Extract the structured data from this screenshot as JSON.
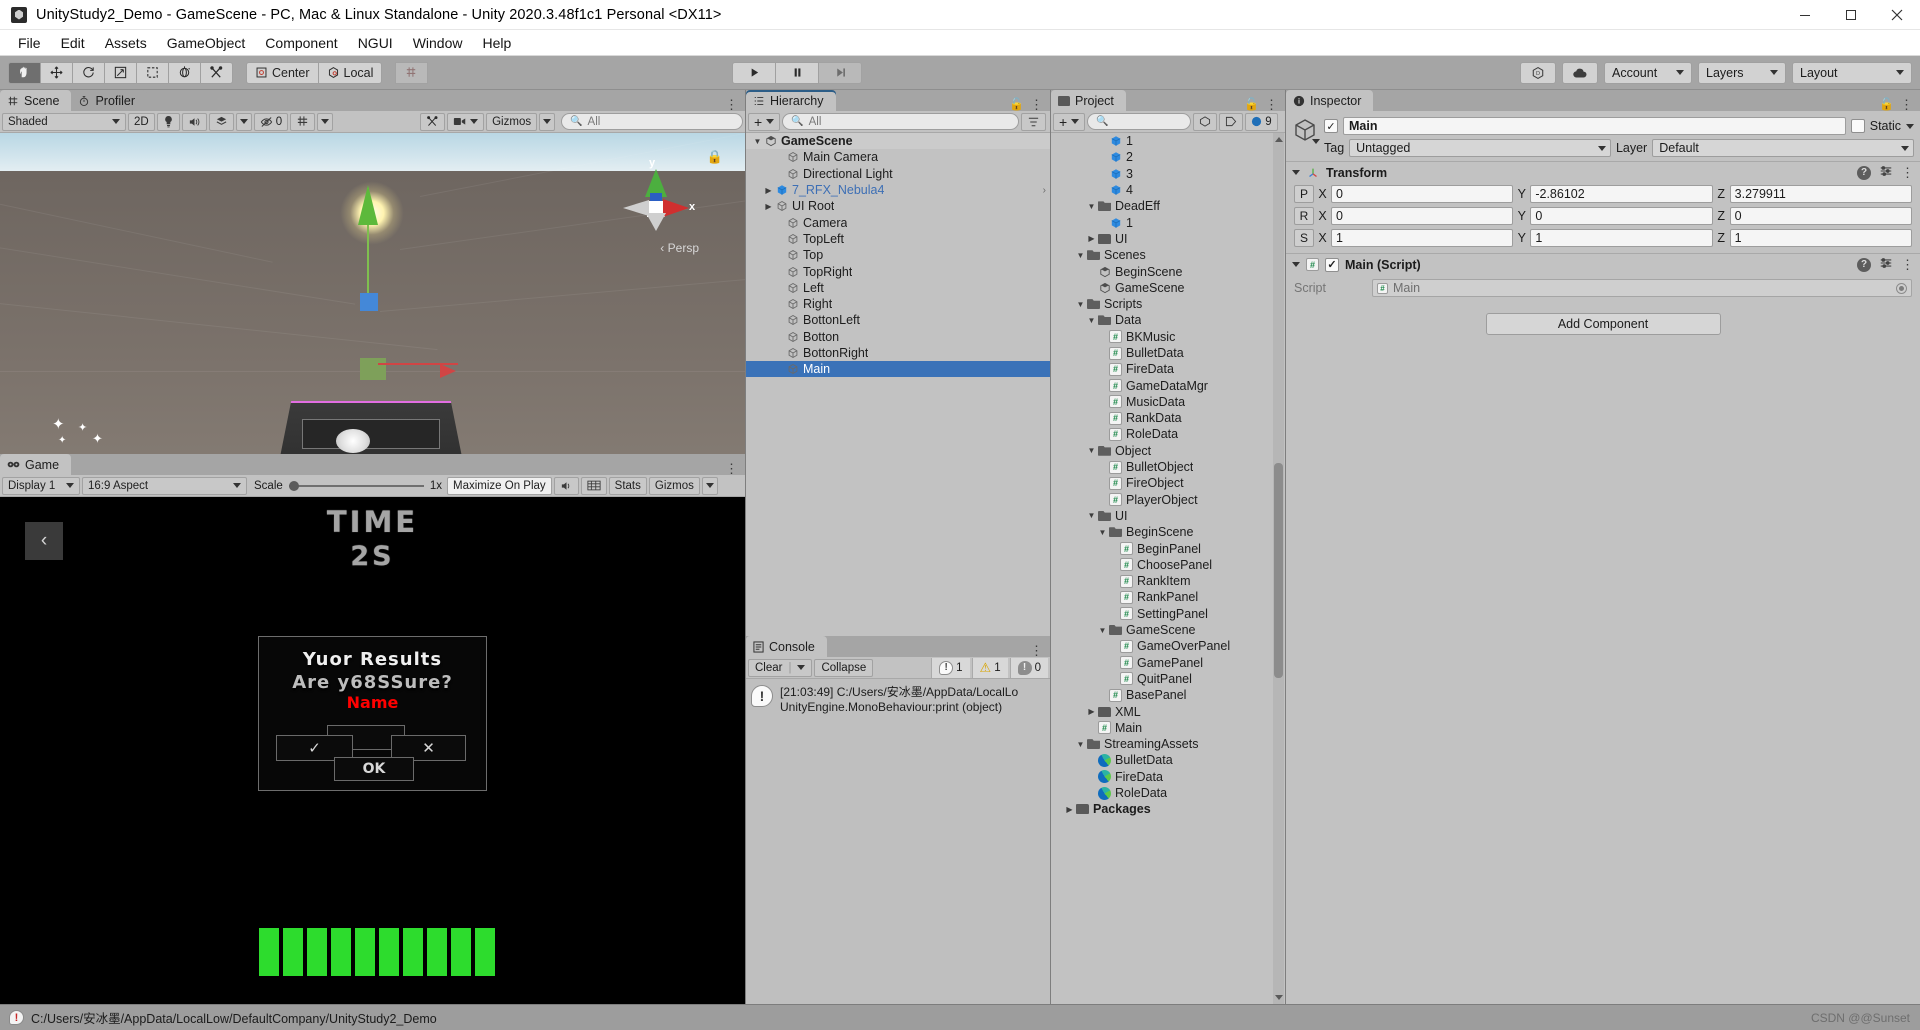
{
  "titlebar": {
    "title": "UnityStudy2_Demo - GameScene - PC, Mac & Linux Standalone - Unity 2020.3.48f1c1 Personal <DX11>",
    "minimize": "—",
    "maximize": "❐",
    "close": "✕"
  },
  "menubar": {
    "items": [
      "File",
      "Edit",
      "Assets",
      "GameObject",
      "Component",
      "NGUI",
      "Window",
      "Help"
    ]
  },
  "toolbar": {
    "tools": [
      "hand-tool",
      "move-tool",
      "rotate-tool",
      "scale-tool",
      "rect-tool",
      "transform-tool",
      "custom-tool"
    ],
    "pivot_label": "Center",
    "space_label": "Local",
    "play": "▶",
    "pause": "❚❚",
    "step": "▶|",
    "collab_label": "",
    "cloud_label": "",
    "account_label": "Account",
    "layers_label": "Layers",
    "layout_label": "Layout"
  },
  "scene": {
    "tabs": [
      {
        "label": "Scene",
        "icon": "grid-icon",
        "active": true
      },
      {
        "label": "Profiler",
        "icon": "stopwatch-icon",
        "active": false
      }
    ],
    "shading_mode": "Shaded",
    "mode_2d": "2D",
    "audio_count": "0",
    "gizmos_label": "Gizmos",
    "search_placeholder": "All",
    "persp_label": "Persp",
    "axis_y": "y",
    "axis_x": "x"
  },
  "game": {
    "tab_label": "Game",
    "display": "Display 1",
    "aspect": "16:9 Aspect",
    "scale_label": "Scale",
    "scale_value": "1x",
    "maximize_label": "Maximize On Play",
    "stats_label": "Stats",
    "gizmos_label": "Gizmos",
    "back_button": "‹",
    "time_label": "TIME",
    "time_value": "2S",
    "dialog": {
      "line1": "Yuor Results",
      "line2": "Are y68SSure?",
      "name": "Name",
      "yes": "✓",
      "no": "✕",
      "ok": "OK"
    },
    "hp_segments": 10
  },
  "hierarchy": {
    "tab_label": "Hierarchy",
    "add_label": "+",
    "search_placeholder": "All",
    "items": [
      {
        "label": "GameScene",
        "depth": 0,
        "icon": "unity-scene-icon",
        "expanded": true,
        "header": true
      },
      {
        "label": "Main Camera",
        "depth": 2,
        "icon": "gameobject-icon"
      },
      {
        "label": "Directional Light",
        "depth": 2,
        "icon": "gameobject-icon"
      },
      {
        "label": "7_RFX_Nebula4",
        "depth": 1,
        "icon": "prefab-icon",
        "collapsed": true,
        "blue": true,
        "chevron": true
      },
      {
        "label": "UI Root",
        "depth": 1,
        "icon": "gameobject-icon",
        "collapsed": true
      },
      {
        "label": "Camera",
        "depth": 2,
        "icon": "gameobject-icon"
      },
      {
        "label": "TopLeft",
        "depth": 2,
        "icon": "gameobject-icon"
      },
      {
        "label": "Top",
        "depth": 2,
        "icon": "gameobject-icon"
      },
      {
        "label": "TopRight",
        "depth": 2,
        "icon": "gameobject-icon"
      },
      {
        "label": "Left",
        "depth": 2,
        "icon": "gameobject-icon"
      },
      {
        "label": "Right",
        "depth": 2,
        "icon": "gameobject-icon"
      },
      {
        "label": "BottonLeft",
        "depth": 2,
        "icon": "gameobject-icon"
      },
      {
        "label": "Botton",
        "depth": 2,
        "icon": "gameobject-icon"
      },
      {
        "label": "BottonRight",
        "depth": 2,
        "icon": "gameobject-icon"
      },
      {
        "label": "Main",
        "depth": 2,
        "icon": "gameobject-icon",
        "selected": true
      }
    ]
  },
  "project": {
    "tab_label": "Project",
    "add_label": "+",
    "search_placeholder": "",
    "count_badge": "9",
    "items": [
      {
        "label": "1",
        "depth": 4,
        "icon": "prefab-icon"
      },
      {
        "label": "2",
        "depth": 4,
        "icon": "prefab-icon"
      },
      {
        "label": "3",
        "depth": 4,
        "icon": "prefab-icon"
      },
      {
        "label": "4",
        "depth": 4,
        "icon": "prefab-icon"
      },
      {
        "label": "DeadEff",
        "depth": 3,
        "icon": "folder-open-icon",
        "expanded": true
      },
      {
        "label": "1",
        "depth": 4,
        "icon": "prefab-icon"
      },
      {
        "label": "UI",
        "depth": 3,
        "icon": "folder-icon",
        "collapsed": true
      },
      {
        "label": "Scenes",
        "depth": 2,
        "icon": "folder-open-icon",
        "expanded": true
      },
      {
        "label": "BeginScene",
        "depth": 3,
        "icon": "unity-scene-icon"
      },
      {
        "label": "GameScene",
        "depth": 3,
        "icon": "unity-scene-icon"
      },
      {
        "label": "Scripts",
        "depth": 2,
        "icon": "folder-open-icon",
        "expanded": true
      },
      {
        "label": "Data",
        "depth": 3,
        "icon": "folder-open-icon",
        "expanded": true
      },
      {
        "label": "BKMusic",
        "depth": 4,
        "icon": "script-icon"
      },
      {
        "label": "BulletData",
        "depth": 4,
        "icon": "script-icon"
      },
      {
        "label": "FireData",
        "depth": 4,
        "icon": "script-icon"
      },
      {
        "label": "GameDataMgr",
        "depth": 4,
        "icon": "script-icon"
      },
      {
        "label": "MusicData",
        "depth": 4,
        "icon": "script-icon"
      },
      {
        "label": "RankData",
        "depth": 4,
        "icon": "script-icon"
      },
      {
        "label": "RoleData",
        "depth": 4,
        "icon": "script-icon"
      },
      {
        "label": "Object",
        "depth": 3,
        "icon": "folder-open-icon",
        "expanded": true
      },
      {
        "label": "BulletObject",
        "depth": 4,
        "icon": "script-icon"
      },
      {
        "label": "FireObject",
        "depth": 4,
        "icon": "script-icon"
      },
      {
        "label": "PlayerObject",
        "depth": 4,
        "icon": "script-icon"
      },
      {
        "label": "UI",
        "depth": 3,
        "icon": "folder-open-icon",
        "expanded": true
      },
      {
        "label": "BeginScene",
        "depth": 4,
        "icon": "folder-open-icon",
        "expanded": true
      },
      {
        "label": "BeginPanel",
        "depth": 5,
        "icon": "script-icon"
      },
      {
        "label": "ChoosePanel",
        "depth": 5,
        "icon": "script-icon"
      },
      {
        "label": "RankItem",
        "depth": 5,
        "icon": "script-icon"
      },
      {
        "label": "RankPanel",
        "depth": 5,
        "icon": "script-icon"
      },
      {
        "label": "SettingPanel",
        "depth": 5,
        "icon": "script-icon"
      },
      {
        "label": "GameScene",
        "depth": 4,
        "icon": "folder-open-icon",
        "expanded": true
      },
      {
        "label": "GameOverPanel",
        "depth": 5,
        "icon": "script-icon"
      },
      {
        "label": "GamePanel",
        "depth": 5,
        "icon": "script-icon"
      },
      {
        "label": "QuitPanel",
        "depth": 5,
        "icon": "script-icon"
      },
      {
        "label": "BasePanel",
        "depth": 4,
        "icon": "script-icon"
      },
      {
        "label": "XML",
        "depth": 3,
        "icon": "folder-icon",
        "collapsed": true
      },
      {
        "label": "Main",
        "depth": 3,
        "icon": "script-icon"
      },
      {
        "label": "StreamingAssets",
        "depth": 2,
        "icon": "folder-open-icon",
        "expanded": true
      },
      {
        "label": "BulletData",
        "depth": 3,
        "icon": "edge-file-icon"
      },
      {
        "label": "FireData",
        "depth": 3,
        "icon": "edge-file-icon"
      },
      {
        "label": "RoleData",
        "depth": 3,
        "icon": "edge-file-icon"
      },
      {
        "label": "Packages",
        "depth": 1,
        "icon": "folder-icon",
        "collapsed": true,
        "bold": true
      }
    ]
  },
  "console": {
    "tab_label": "Console",
    "clear_label": "Clear",
    "collapse_label": "Collapse",
    "error_count": "1",
    "warning_count": "1",
    "info_count": "0",
    "message_line1": "[21:03:49] C:/Users/安冰墨/AppData/LocalLo",
    "message_line2": "UnityEngine.MonoBehaviour:print (object)"
  },
  "inspector": {
    "tab_label": "Inspector",
    "object_name": "Main",
    "static_label": "Static",
    "tag_label": "Tag",
    "tag_value": "Untagged",
    "layer_label": "Layer",
    "layer_value": "Default",
    "transform": {
      "title": "Transform",
      "rows": [
        {
          "prefix": "P",
          "x": "0",
          "y": "-2.86102",
          "z": "3.279911"
        },
        {
          "prefix": "R",
          "x": "0",
          "y": "0",
          "z": "0"
        },
        {
          "prefix": "S",
          "x": "1",
          "y": "1",
          "z": "1"
        }
      ]
    },
    "script_component": {
      "title": "Main (Script)",
      "field_label": "Script",
      "field_value": "Main"
    },
    "add_component_label": "Add Component"
  },
  "statusbar": {
    "message": "C:/Users/安冰墨/AppData/LocalLow/DefaultCompany/UnityStudy2_Demo",
    "watermark": "CSDN @@Sunset"
  },
  "colors": {
    "selection": "#3a72b8",
    "prefab_blue": "#3d6fb5",
    "warning": "#d9a500",
    "hp_green": "#2ddc2d",
    "dialog_red": "#ff0000"
  }
}
